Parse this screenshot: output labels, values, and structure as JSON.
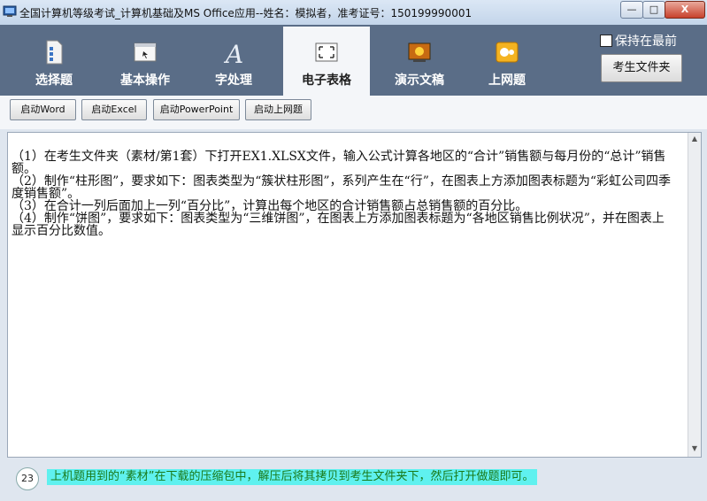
{
  "window": {
    "title": "全国计算机等级考试_计算机基础及MS Office应用--姓名：模拟者，准考证号：150199990001",
    "min_label": "—",
    "max_label": "□",
    "close_label": "X"
  },
  "tabs": [
    {
      "label": "选择题",
      "icon": "document-icon"
    },
    {
      "label": "基本操作",
      "icon": "window-icon"
    },
    {
      "label": "字处理",
      "icon": "letter-a-icon"
    },
    {
      "label": "电子表格",
      "icon": "spreadsheet-icon"
    },
    {
      "label": "演示文稿",
      "icon": "presentation-icon"
    },
    {
      "label": "上网题",
      "icon": "internet-icon"
    }
  ],
  "active_tab": "电子表格",
  "keep_on_top": {
    "label": "保持在最前",
    "checked": false
  },
  "candidate_folder_button": "考生文件夹",
  "toolbar": {
    "word": "启动Word",
    "excel": "启动Excel",
    "powerpoint": "启动PowerPoint",
    "internet": "启动上网题"
  },
  "questions": [
    "（1）在考生文件夹（素材/第1套）下打开EX1.XLSX文件，输入公式计算各地区的“合计”销售额与每月份的“总计”销售额。",
    "（2）制作“柱形图”，要求如下：图表类型为“簇状柱形图”，系列产生在“行”，在图表上方添加图表标题为“彩虹公司四季度销售额”。",
    "（3）在合计一列后面加上一列“百分比”，计算出每个地区的合计销售额占总销售额的百分比。",
    "（4）制作“饼图”，要求如下：图表类型为“三维饼图”，在图表上方添加图表标题为“各地区销售比例状况”，并在图表上显示百分比数值。"
  ],
  "status": {
    "count": "23",
    "notice": "上机题用到的“素材”在下载的压缩包中，解压后将其拷贝到考生文件夹下，然后打开做题即可。"
  },
  "colors": {
    "tabbar": "#5a6d87",
    "notice_bg": "#5ff1ef",
    "notice_text": "#1a7a1a"
  }
}
